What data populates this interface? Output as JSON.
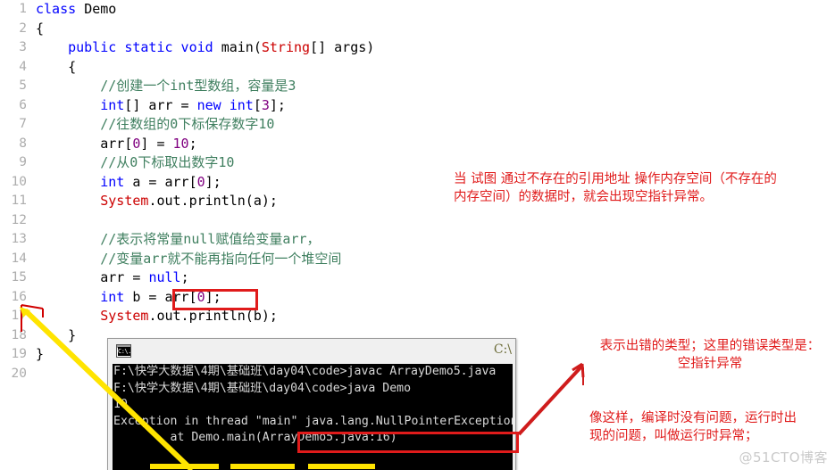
{
  "editor": {
    "lines": [
      {
        "n": "1",
        "tokens": [
          {
            "t": "class ",
            "c": "kw"
          },
          {
            "t": "Demo",
            "c": "plain"
          }
        ]
      },
      {
        "n": "2",
        "tokens": [
          {
            "t": "{",
            "c": "plain"
          }
        ]
      },
      {
        "n": "3",
        "tokens": [
          {
            "t": "    ",
            "c": "plain"
          },
          {
            "t": "public static void ",
            "c": "kw"
          },
          {
            "t": "main(",
            "c": "plain"
          },
          {
            "t": "String",
            "c": "cls"
          },
          {
            "t": "[] args)",
            "c": "plain"
          }
        ]
      },
      {
        "n": "4",
        "tokens": [
          {
            "t": "    {",
            "c": "plain"
          }
        ]
      },
      {
        "n": "5",
        "tokens": [
          {
            "t": "        ",
            "c": "plain"
          },
          {
            "t": "//创建一个int型数组，容量是3",
            "c": "cmt"
          }
        ]
      },
      {
        "n": "6",
        "tokens": [
          {
            "t": "        ",
            "c": "plain"
          },
          {
            "t": "int",
            "c": "kw"
          },
          {
            "t": "[] arr = ",
            "c": "plain"
          },
          {
            "t": "new int",
            "c": "kw"
          },
          {
            "t": "[",
            "c": "plain"
          },
          {
            "t": "3",
            "c": "num"
          },
          {
            "t": "];",
            "c": "plain"
          }
        ]
      },
      {
        "n": "7",
        "tokens": [
          {
            "t": "        ",
            "c": "plain"
          },
          {
            "t": "//往数组的0下标保存数字10",
            "c": "cmt"
          }
        ]
      },
      {
        "n": "8",
        "tokens": [
          {
            "t": "        arr[",
            "c": "plain"
          },
          {
            "t": "0",
            "c": "num"
          },
          {
            "t": "] = ",
            "c": "plain"
          },
          {
            "t": "10",
            "c": "num"
          },
          {
            "t": ";",
            "c": "plain"
          }
        ]
      },
      {
        "n": "9",
        "tokens": [
          {
            "t": "        ",
            "c": "plain"
          },
          {
            "t": "//从0下标取出数字10",
            "c": "cmt"
          }
        ]
      },
      {
        "n": "10",
        "tokens": [
          {
            "t": "        ",
            "c": "plain"
          },
          {
            "t": "int",
            "c": "kw"
          },
          {
            "t": " a = arr[",
            "c": "plain"
          },
          {
            "t": "0",
            "c": "num"
          },
          {
            "t": "];",
            "c": "plain"
          }
        ]
      },
      {
        "n": "11",
        "tokens": [
          {
            "t": "        ",
            "c": "plain"
          },
          {
            "t": "System",
            "c": "cls"
          },
          {
            "t": ".out.println(a);",
            "c": "plain"
          }
        ]
      },
      {
        "n": "12",
        "tokens": []
      },
      {
        "n": "13",
        "tokens": [
          {
            "t": "        ",
            "c": "plain"
          },
          {
            "t": "//表示将常量null赋值给变量arr，",
            "c": "cmt"
          }
        ]
      },
      {
        "n": "14",
        "tokens": [
          {
            "t": "        ",
            "c": "plain"
          },
          {
            "t": "//变量arr就不能再指向任何一个堆空间",
            "c": "cmt"
          }
        ]
      },
      {
        "n": "15",
        "tokens": [
          {
            "t": "        arr = ",
            "c": "plain"
          },
          {
            "t": "null",
            "c": "kw"
          },
          {
            "t": ";",
            "c": "plain"
          }
        ]
      },
      {
        "n": "16",
        "tokens": [
          {
            "t": "        ",
            "c": "plain"
          },
          {
            "t": "int",
            "c": "kw"
          },
          {
            "t": " b = arr[",
            "c": "plain"
          },
          {
            "t": "0",
            "c": "num"
          },
          {
            "t": "];",
            "c": "plain"
          }
        ]
      },
      {
        "n": "17",
        "tokens": [
          {
            "t": "        ",
            "c": "plain"
          },
          {
            "t": "System",
            "c": "cls"
          },
          {
            "t": ".out.println(b);",
            "c": "plain"
          }
        ]
      },
      {
        "n": "18",
        "tokens": [
          {
            "t": "    }",
            "c": "plain"
          }
        ]
      },
      {
        "n": "19",
        "tokens": [
          {
            "t": "}",
            "c": "plain"
          }
        ]
      },
      {
        "n": "20",
        "tokens": []
      }
    ],
    "highlight_expression": "arr[0];"
  },
  "console": {
    "title": "C:\\",
    "icon": "cmd-icon",
    "lines": [
      "F:\\快学大数据\\4期\\基础班\\day04\\code>javac ArrayDemo5.java",
      "",
      "F:\\快学大数据\\4期\\基础班\\day04\\code>java Demo",
      "10",
      "Exception in thread \"main\" java.lang.NullPointerException",
      "        at Demo.main(ArrayDemo5.java:16)"
    ],
    "highlighted_exception": "java.lang.NullPointerException"
  },
  "annotations": {
    "note_npe_definition": "当 试图 通过不存在的引用地址 操作内存空间（不存在的\n内存空间）的数据时，就会出现空指针异常。",
    "note_error_type": "表示出错的类型；这里的错误类型是：\n空指针异常",
    "note_runtime_exception": "像这样，编译时没有问题，运行时出\n现的问题，叫做运行时异常；"
  },
  "watermark": "@51CTO博客",
  "colors": {
    "keyword": "#0000ff",
    "class": "#cc0000",
    "comment": "#3f7f5f",
    "number": "#800080",
    "annotation_red": "#e01b1b",
    "arrow_yellow": "#ffe400",
    "console_bg": "#000000",
    "gutter": "#adadad"
  }
}
